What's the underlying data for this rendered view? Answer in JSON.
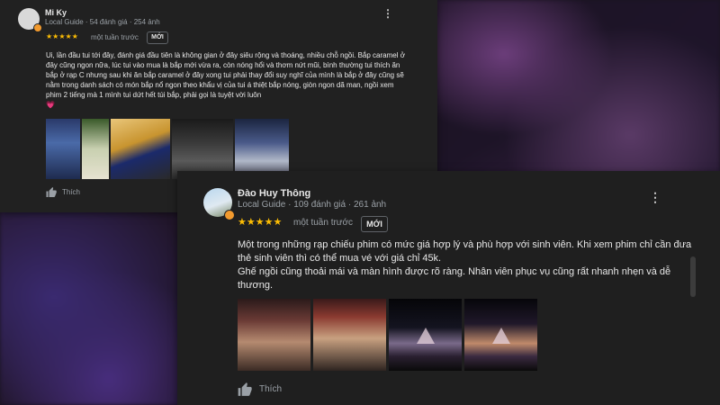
{
  "review1": {
    "name": "Mi Ky",
    "meta": "Local Guide · 54 đánh giá · 254 ảnh",
    "stars": "★★★★★",
    "time": "một tuần trước",
    "new_tag": "MỚI",
    "text": "Ui, lần đầu tui tới đây, đánh giá đầu tiên là không gian ở đây siêu rộng và thoáng, nhiều chỗ ngồi. Bắp caramel ở đây cũng ngon nữa, lúc tui vào mua là bắp mới vừa ra, còn nóng hổi và thơm nứt mũi, bình thường tui thích ăn bắp ở rạp C nhưng sau khi ăn bắp caramel ở đây xong tui phải thay đổi suy nghĩ của mình là bắp ở đây cũng sẽ nằm trong danh sách có món bắp nổ ngon theo khẩu vị của tui á  thiệt bắp nóng, giòn ngon dã man, ngồi xem phim 2 tiếng mà 1 mình tui dứt hết túi bắp, phải gọi là tuyệt vời luôn\n💗",
    "like_label": "Thích"
  },
  "review2": {
    "name": "Đào Huy Thông",
    "meta": "Local Guide · 109 đánh giá · 261 ảnh",
    "stars": "★★★★★",
    "time": "một tuần trước",
    "new_tag": "MỚI",
    "text": "Một trong những rạp chiếu phim có mức giá hợp lý và phù hợp với sinh viên. Khi xem phim chỉ cần đưa thẻ sinh viên thì có thể mua vé với giá chỉ 45k.\nGhế ngồi cũng thoải mái và màn hình được rõ ràng. Nhân viên phục vụ cũng rất nhanh nhẹn và dễ thương.",
    "like_label": "Thích"
  },
  "icons": {
    "kebab": "more-vert-icon",
    "like": "thumb-up-icon",
    "badge": "local-guide-badge-icon"
  },
  "colors": {
    "stars": "#fbbc04",
    "card_bg": "#212121",
    "badge": "#f29a2e"
  }
}
